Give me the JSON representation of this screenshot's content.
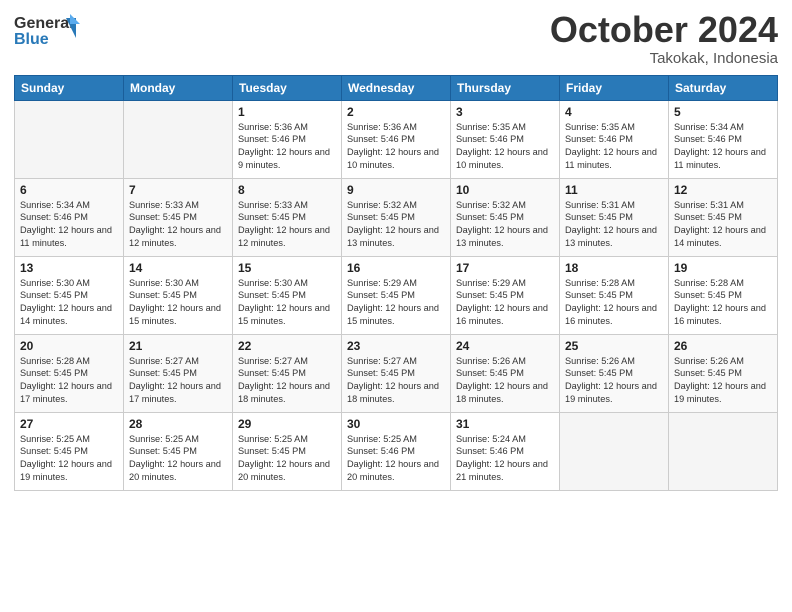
{
  "header": {
    "logo_line1": "General",
    "logo_line2": "Blue",
    "month_title": "October 2024",
    "location": "Takokak, Indonesia"
  },
  "weekdays": [
    "Sunday",
    "Monday",
    "Tuesday",
    "Wednesday",
    "Thursday",
    "Friday",
    "Saturday"
  ],
  "weeks": [
    [
      {
        "day": "",
        "sunrise": "",
        "sunset": "",
        "daylight": ""
      },
      {
        "day": "",
        "sunrise": "",
        "sunset": "",
        "daylight": ""
      },
      {
        "day": "1",
        "sunrise": "Sunrise: 5:36 AM",
        "sunset": "Sunset: 5:46 PM",
        "daylight": "Daylight: 12 hours and 9 minutes."
      },
      {
        "day": "2",
        "sunrise": "Sunrise: 5:36 AM",
        "sunset": "Sunset: 5:46 PM",
        "daylight": "Daylight: 12 hours and 10 minutes."
      },
      {
        "day": "3",
        "sunrise": "Sunrise: 5:35 AM",
        "sunset": "Sunset: 5:46 PM",
        "daylight": "Daylight: 12 hours and 10 minutes."
      },
      {
        "day": "4",
        "sunrise": "Sunrise: 5:35 AM",
        "sunset": "Sunset: 5:46 PM",
        "daylight": "Daylight: 12 hours and 11 minutes."
      },
      {
        "day": "5",
        "sunrise": "Sunrise: 5:34 AM",
        "sunset": "Sunset: 5:46 PM",
        "daylight": "Daylight: 12 hours and 11 minutes."
      }
    ],
    [
      {
        "day": "6",
        "sunrise": "Sunrise: 5:34 AM",
        "sunset": "Sunset: 5:46 PM",
        "daylight": "Daylight: 12 hours and 11 minutes."
      },
      {
        "day": "7",
        "sunrise": "Sunrise: 5:33 AM",
        "sunset": "Sunset: 5:45 PM",
        "daylight": "Daylight: 12 hours and 12 minutes."
      },
      {
        "day": "8",
        "sunrise": "Sunrise: 5:33 AM",
        "sunset": "Sunset: 5:45 PM",
        "daylight": "Daylight: 12 hours and 12 minutes."
      },
      {
        "day": "9",
        "sunrise": "Sunrise: 5:32 AM",
        "sunset": "Sunset: 5:45 PM",
        "daylight": "Daylight: 12 hours and 13 minutes."
      },
      {
        "day": "10",
        "sunrise": "Sunrise: 5:32 AM",
        "sunset": "Sunset: 5:45 PM",
        "daylight": "Daylight: 12 hours and 13 minutes."
      },
      {
        "day": "11",
        "sunrise": "Sunrise: 5:31 AM",
        "sunset": "Sunset: 5:45 PM",
        "daylight": "Daylight: 12 hours and 13 minutes."
      },
      {
        "day": "12",
        "sunrise": "Sunrise: 5:31 AM",
        "sunset": "Sunset: 5:45 PM",
        "daylight": "Daylight: 12 hours and 14 minutes."
      }
    ],
    [
      {
        "day": "13",
        "sunrise": "Sunrise: 5:30 AM",
        "sunset": "Sunset: 5:45 PM",
        "daylight": "Daylight: 12 hours and 14 minutes."
      },
      {
        "day": "14",
        "sunrise": "Sunrise: 5:30 AM",
        "sunset": "Sunset: 5:45 PM",
        "daylight": "Daylight: 12 hours and 15 minutes."
      },
      {
        "day": "15",
        "sunrise": "Sunrise: 5:30 AM",
        "sunset": "Sunset: 5:45 PM",
        "daylight": "Daylight: 12 hours and 15 minutes."
      },
      {
        "day": "16",
        "sunrise": "Sunrise: 5:29 AM",
        "sunset": "Sunset: 5:45 PM",
        "daylight": "Daylight: 12 hours and 15 minutes."
      },
      {
        "day": "17",
        "sunrise": "Sunrise: 5:29 AM",
        "sunset": "Sunset: 5:45 PM",
        "daylight": "Daylight: 12 hours and 16 minutes."
      },
      {
        "day": "18",
        "sunrise": "Sunrise: 5:28 AM",
        "sunset": "Sunset: 5:45 PM",
        "daylight": "Daylight: 12 hours and 16 minutes."
      },
      {
        "day": "19",
        "sunrise": "Sunrise: 5:28 AM",
        "sunset": "Sunset: 5:45 PM",
        "daylight": "Daylight: 12 hours and 16 minutes."
      }
    ],
    [
      {
        "day": "20",
        "sunrise": "Sunrise: 5:28 AM",
        "sunset": "Sunset: 5:45 PM",
        "daylight": "Daylight: 12 hours and 17 minutes."
      },
      {
        "day": "21",
        "sunrise": "Sunrise: 5:27 AM",
        "sunset": "Sunset: 5:45 PM",
        "daylight": "Daylight: 12 hours and 17 minutes."
      },
      {
        "day": "22",
        "sunrise": "Sunrise: 5:27 AM",
        "sunset": "Sunset: 5:45 PM",
        "daylight": "Daylight: 12 hours and 18 minutes."
      },
      {
        "day": "23",
        "sunrise": "Sunrise: 5:27 AM",
        "sunset": "Sunset: 5:45 PM",
        "daylight": "Daylight: 12 hours and 18 minutes."
      },
      {
        "day": "24",
        "sunrise": "Sunrise: 5:26 AM",
        "sunset": "Sunset: 5:45 PM",
        "daylight": "Daylight: 12 hours and 18 minutes."
      },
      {
        "day": "25",
        "sunrise": "Sunrise: 5:26 AM",
        "sunset": "Sunset: 5:45 PM",
        "daylight": "Daylight: 12 hours and 19 minutes."
      },
      {
        "day": "26",
        "sunrise": "Sunrise: 5:26 AM",
        "sunset": "Sunset: 5:45 PM",
        "daylight": "Daylight: 12 hours and 19 minutes."
      }
    ],
    [
      {
        "day": "27",
        "sunrise": "Sunrise: 5:25 AM",
        "sunset": "Sunset: 5:45 PM",
        "daylight": "Daylight: 12 hours and 19 minutes."
      },
      {
        "day": "28",
        "sunrise": "Sunrise: 5:25 AM",
        "sunset": "Sunset: 5:45 PM",
        "daylight": "Daylight: 12 hours and 20 minutes."
      },
      {
        "day": "29",
        "sunrise": "Sunrise: 5:25 AM",
        "sunset": "Sunset: 5:45 PM",
        "daylight": "Daylight: 12 hours and 20 minutes."
      },
      {
        "day": "30",
        "sunrise": "Sunrise: 5:25 AM",
        "sunset": "Sunset: 5:46 PM",
        "daylight": "Daylight: 12 hours and 20 minutes."
      },
      {
        "day": "31",
        "sunrise": "Sunrise: 5:24 AM",
        "sunset": "Sunset: 5:46 PM",
        "daylight": "Daylight: 12 hours and 21 minutes."
      },
      {
        "day": "",
        "sunrise": "",
        "sunset": "",
        "daylight": ""
      },
      {
        "day": "",
        "sunrise": "",
        "sunset": "",
        "daylight": ""
      }
    ]
  ]
}
